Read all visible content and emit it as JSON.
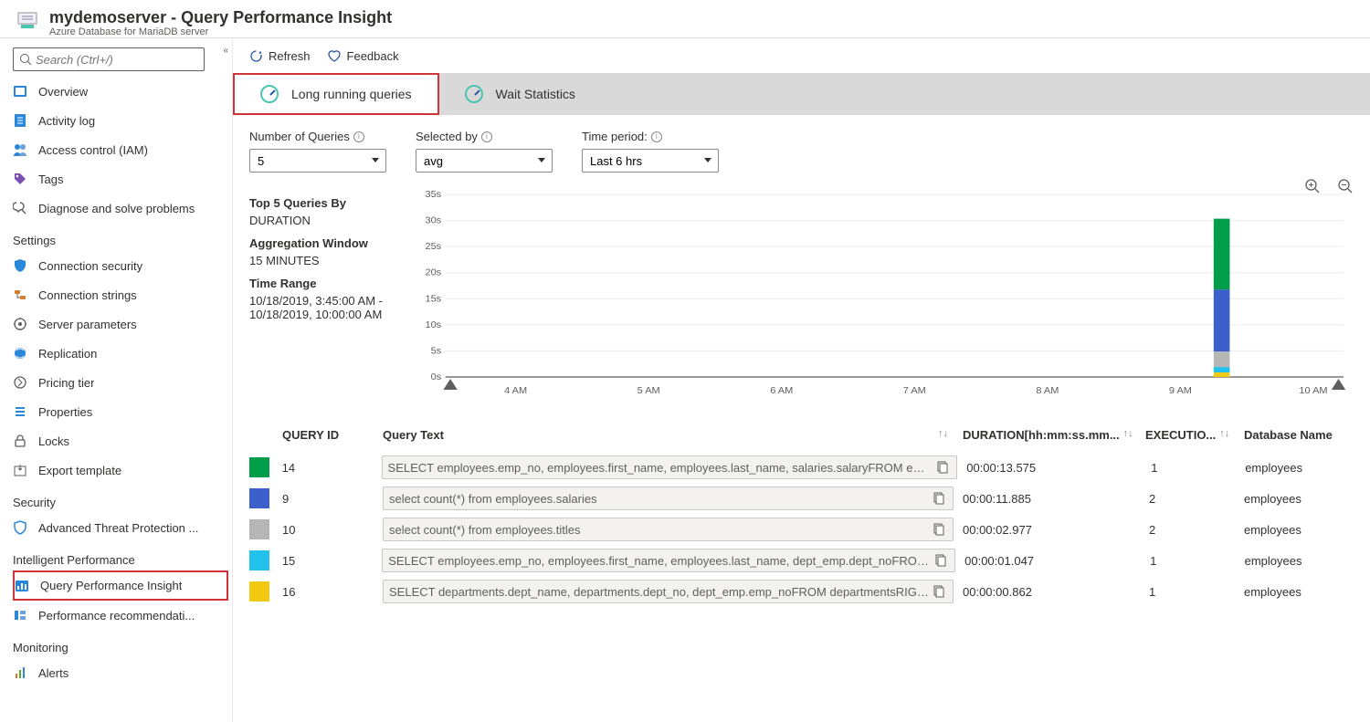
{
  "header": {
    "title": "mydemoserver - Query Performance Insight",
    "subtitle": "Azure Database for MariaDB server"
  },
  "search": {
    "placeholder": "Search (Ctrl+/)"
  },
  "sidebar": {
    "top": [
      {
        "label": "Overview"
      },
      {
        "label": "Activity log"
      },
      {
        "label": "Access control (IAM)"
      },
      {
        "label": "Tags"
      },
      {
        "label": "Diagnose and solve problems"
      }
    ],
    "sections": [
      {
        "title": "Settings",
        "items": [
          {
            "label": "Connection security"
          },
          {
            "label": "Connection strings"
          },
          {
            "label": "Server parameters"
          },
          {
            "label": "Replication"
          },
          {
            "label": "Pricing tier"
          },
          {
            "label": "Properties"
          },
          {
            "label": "Locks"
          },
          {
            "label": "Export template"
          }
        ]
      },
      {
        "title": "Security",
        "items": [
          {
            "label": "Advanced Threat Protection ..."
          }
        ]
      },
      {
        "title": "Intelligent Performance",
        "items": [
          {
            "label": "Query Performance Insight",
            "active": true
          },
          {
            "label": "Performance recommendati..."
          }
        ]
      },
      {
        "title": "Monitoring",
        "items": [
          {
            "label": "Alerts"
          }
        ]
      }
    ]
  },
  "toolbar": {
    "refresh": "Refresh",
    "feedback": "Feedback"
  },
  "tabs": {
    "longRunning": "Long running queries",
    "waitStats": "Wait Statistics"
  },
  "filters": {
    "numQueries": {
      "label": "Number of Queries",
      "value": "5"
    },
    "selectedBy": {
      "label": "Selected by",
      "value": "avg"
    },
    "timePeriod": {
      "label": "Time period:",
      "value": "Last 6 hrs"
    }
  },
  "chartInfo": {
    "titleA": "Top 5 Queries By",
    "valA": "DURATION",
    "titleB": "Aggregation Window",
    "valB": "15 MINUTES",
    "titleC": "Time Range",
    "valC": "10/18/2019, 3:45:00 AM - 10/18/2019, 10:00:00 AM"
  },
  "chart_data": {
    "type": "bar",
    "ylabel": "seconds",
    "ylim": [
      0,
      35
    ],
    "y_ticks": [
      "0s",
      "5s",
      "10s",
      "15s",
      "20s",
      "25s",
      "30s",
      "35s"
    ],
    "x_ticks": [
      "4 AM",
      "5 AM",
      "6 AM",
      "7 AM",
      "8 AM",
      "9 AM",
      "10 AM"
    ],
    "stack_at": "9:15 AM",
    "series": [
      {
        "name": "14",
        "color": "#009e49",
        "value": 13.575
      },
      {
        "name": "9",
        "color": "#3b5fcb",
        "value": 11.885
      },
      {
        "name": "10",
        "color": "#b6b6b6",
        "value": 2.977
      },
      {
        "name": "15",
        "color": "#21c1ec",
        "value": 1.047
      },
      {
        "name": "16",
        "color": "#f2c811",
        "value": 0.862
      }
    ]
  },
  "table": {
    "headers": {
      "id": "QUERY ID",
      "text": "Query Text",
      "dur": "DURATION[hh:mm:ss.mm...",
      "exec": "EXECUTIO...",
      "db": "Database Name"
    },
    "rows": [
      {
        "color": "#009e49",
        "id": "14",
        "text": "SELECT employees.emp_no, employees.first_name, employees.last_name, salaries.salaryFROM empl...",
        "dur": "00:00:13.575",
        "exec": "1",
        "db": "employees"
      },
      {
        "color": "#3b5fcb",
        "id": "9",
        "text": "select count(*) from employees.salaries",
        "dur": "00:00:11.885",
        "exec": "2",
        "db": "employees"
      },
      {
        "color": "#b6b6b6",
        "id": "10",
        "text": "select count(*) from employees.titles",
        "dur": "00:00:02.977",
        "exec": "2",
        "db": "employees"
      },
      {
        "color": "#21c1ec",
        "id": "15",
        "text": "SELECT employees.emp_no, employees.first_name, employees.last_name, dept_emp.dept_noFROM ...",
        "dur": "00:00:01.047",
        "exec": "1",
        "db": "employees"
      },
      {
        "color": "#f2c811",
        "id": "16",
        "text": "SELECT departments.dept_name, departments.dept_no, dept_emp.emp_noFROM departmentsRIGH...",
        "dur": "00:00:00.862",
        "exec": "1",
        "db": "employees"
      }
    ]
  }
}
